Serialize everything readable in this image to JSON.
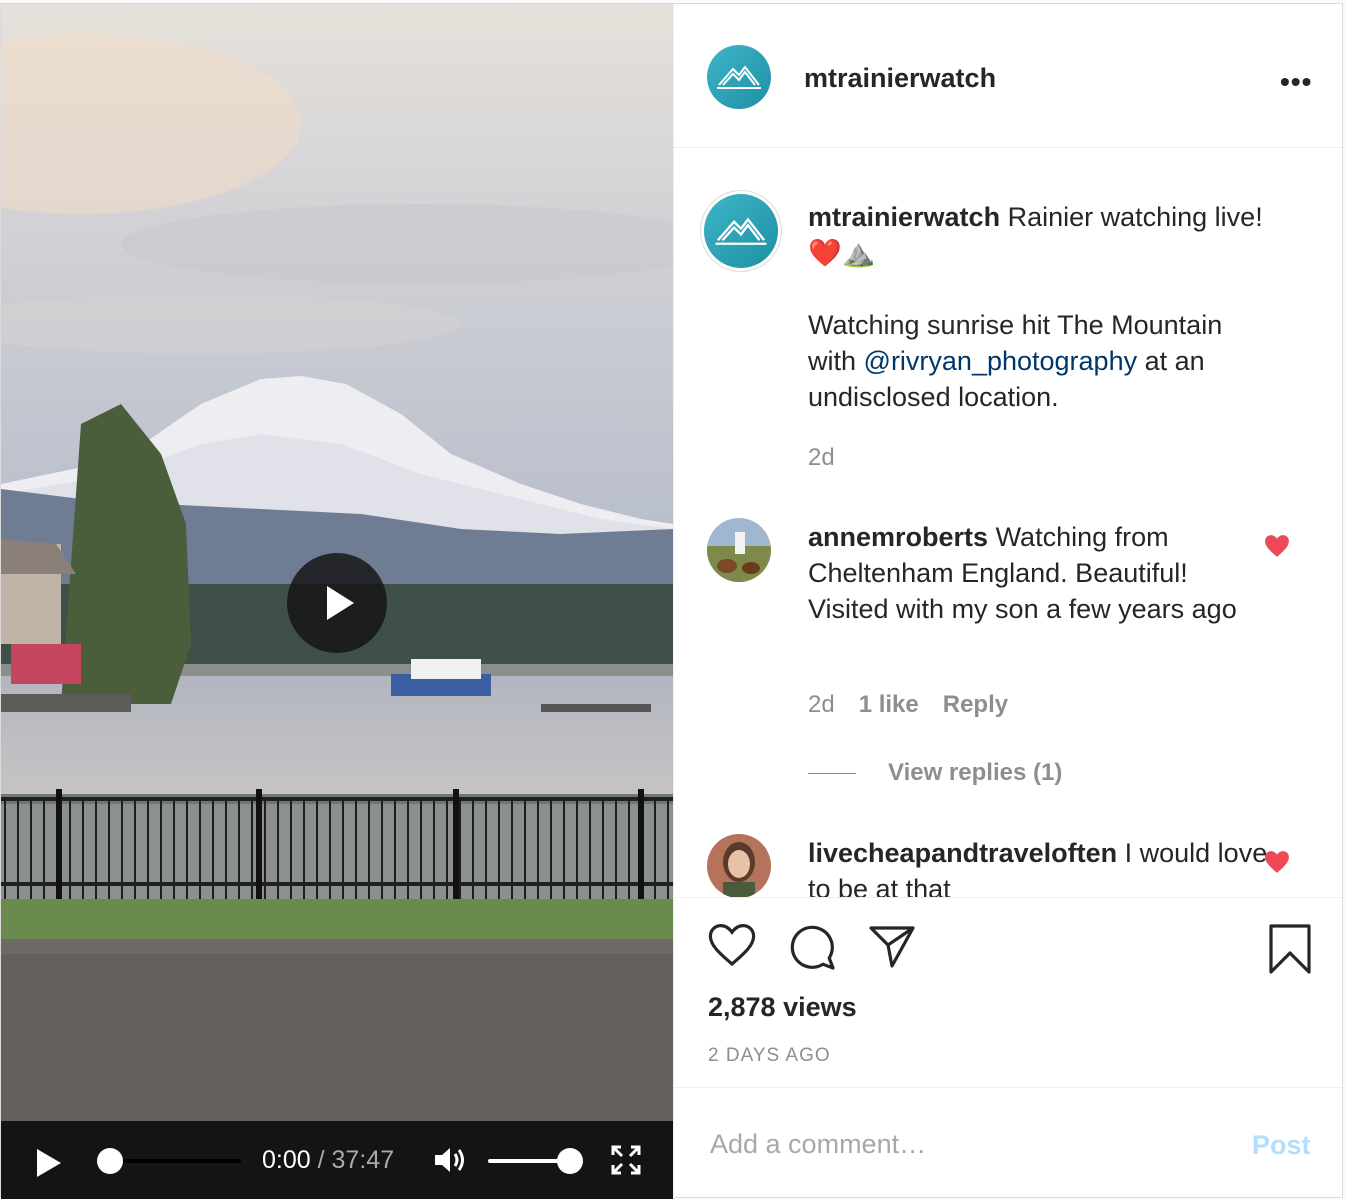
{
  "video": {
    "time_current": "0:00",
    "time_separator": "/",
    "time_total": "37:47",
    "progress": 0,
    "volume": 1
  },
  "header": {
    "username": "mtrainierwatch",
    "more_label": "•••"
  },
  "caption": {
    "username": "mtrainierwatch",
    "text1": "Rainier watching live! ❤️⛰️",
    "text2_before": "Watching sunrise hit The Mountain with ",
    "mention": "@rivryan_photography",
    "text2_after": " at an undisclosed location.",
    "time": "2d"
  },
  "comments": [
    {
      "username": "annemroberts",
      "text": "Watching from Cheltenham England. Beautiful! Visited with my son a few years ago",
      "time": "2d",
      "likes": "1 like",
      "reply": "Reply",
      "view_replies": "View replies (1)",
      "liked": true
    },
    {
      "username": "livecheapandtraveloften",
      "text": "I would love to be at that",
      "liked": true
    }
  ],
  "stats": {
    "views": "2,878 views",
    "posted": "2 DAYS AGO"
  },
  "comment_box": {
    "placeholder": "Add a comment…",
    "post_label": "Post"
  },
  "colors": {
    "like_red": "#ed4956",
    "link_blue": "#00376b",
    "post_disabled": "#b2dffc"
  }
}
